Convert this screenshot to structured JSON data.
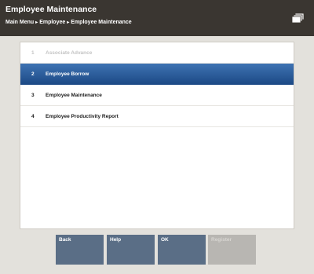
{
  "header": {
    "title": "Employee Maintenance",
    "breadcrumb": [
      "Main Menu",
      "Employee",
      "Employee Maintenance"
    ],
    "separator": "▸"
  },
  "menu": {
    "items": [
      {
        "number": "1",
        "label": "Associate Advance",
        "state": "disabled"
      },
      {
        "number": "2",
        "label": "Employee Borrow",
        "state": "selected"
      },
      {
        "number": "3",
        "label": "Employee Maintenance",
        "state": "normal"
      },
      {
        "number": "4",
        "label": "Employee Productivity Report",
        "state": "normal"
      }
    ]
  },
  "buttons": {
    "back": "Back",
    "help": "Help",
    "ok": "OK",
    "disabled_label": "Register"
  },
  "colors": {
    "header_bg": "#3a3631",
    "selected_row": "#2a5ea0",
    "button_bg": "#5a6e86"
  }
}
